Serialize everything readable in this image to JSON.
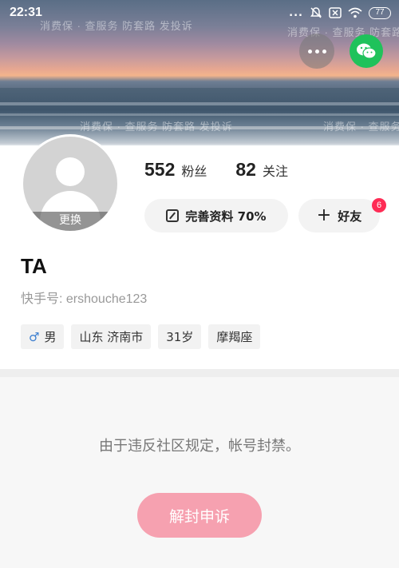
{
  "status_bar": {
    "time": "22:31",
    "signal_dots": "...",
    "battery": "77"
  },
  "watermark": {
    "text": "消费保 · 查服务 防套路 发投诉"
  },
  "header": {
    "more_icon": "more-horizontal-icon",
    "wechat_icon": "wechat-icon",
    "wechat_color": "#1fc25b"
  },
  "profile": {
    "avatar_change_label": "更换",
    "followers_count": "552",
    "followers_label": "粉丝",
    "following_count": "82",
    "following_label": "关注",
    "edit_profile_label": "完善资料 70%",
    "add_friend_label": "好友",
    "friend_badge": "6",
    "name": "TA",
    "kuaishou_id_label": "快手号: ",
    "kuaishou_id": "ershouche123",
    "tags": {
      "gender": "男",
      "location": "山东 济南市",
      "age": "31岁",
      "zodiac": "摩羯座"
    }
  },
  "ban": {
    "message": "由于违反社区规定，帐号封禁。",
    "appeal_button": "解封申诉",
    "appeal_color": "#f6a1b0"
  },
  "colors": {
    "badge": "#fe2c55",
    "male_icon": "#3b7ecf"
  }
}
